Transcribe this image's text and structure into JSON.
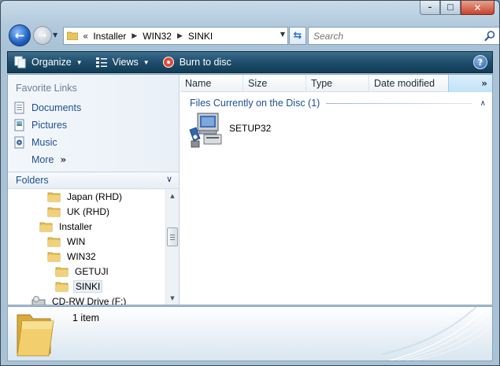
{
  "window": {
    "caption_buttons": {
      "minimize": "–",
      "maximize": "□",
      "close": "✕"
    }
  },
  "nav": {
    "back_glyph": "←",
    "forward_glyph": "→",
    "history_dropdown": "▼",
    "address_overflow": "«",
    "breadcrumbs": [
      "Installer",
      "WIN32",
      "SINKI"
    ],
    "crumb_separator": "▶",
    "address_dropdown": "▼",
    "refresh_glyph": "⇆",
    "search_placeholder": "Search"
  },
  "toolbar": {
    "organize": "Organize",
    "views": "Views",
    "burn": "Burn to disc",
    "dropdown": "▼",
    "help": "?"
  },
  "favorites": {
    "title": "Favorite Links",
    "items": [
      "Documents",
      "Pictures",
      "Music",
      "More"
    ],
    "more_chevron": "»"
  },
  "folders": {
    "title": "Folders",
    "collapse_chevron": "∨",
    "tree": [
      {
        "label": "Japan (RHD)",
        "indent": 2
      },
      {
        "label": "UK (RHD)",
        "indent": 2
      },
      {
        "label": "Installer",
        "indent": 1
      },
      {
        "label": "WIN",
        "indent": 2
      },
      {
        "label": "WIN32",
        "indent": 2
      },
      {
        "label": "GETUJI",
        "indent": 3
      },
      {
        "label": "SINKI",
        "indent": 3,
        "selected": true
      },
      {
        "label": "CD-RW Drive (F:)",
        "indent": 0
      }
    ],
    "scroll_up": "▲",
    "scroll_down": "▼"
  },
  "columns": {
    "headers": [
      "Name",
      "Size",
      "Type",
      "Date modified"
    ],
    "more": "»"
  },
  "group": {
    "label": "Files Currently on the Disc (1)",
    "chevron": "∧"
  },
  "files": [
    {
      "name": "SETUP32",
      "icon": "setup-installer-icon"
    }
  ],
  "details": {
    "count": "1 item"
  },
  "colors": {
    "accent_blue": "#1e4f94",
    "command_bar": "#1f4d6b",
    "selection": "#e8eef4"
  }
}
